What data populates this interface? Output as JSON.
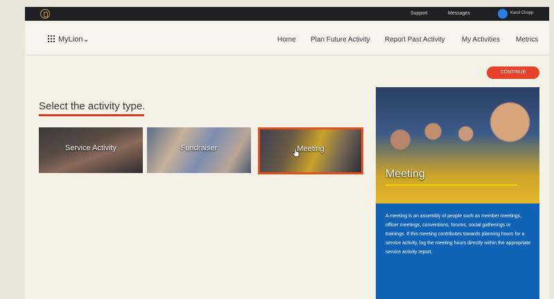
{
  "topbar": {
    "support": "Support",
    "messages": "Messages",
    "user_name": "Karol Chopp"
  },
  "navbar": {
    "brand": "MyLion",
    "items": [
      "Home",
      "Plan Future Activity",
      "Report Past Activity",
      "My Activities",
      "Metrics"
    ]
  },
  "main": {
    "continue_label": "CONTINUE",
    "heading": "Select the activity type.",
    "tiles": [
      {
        "label": "Service Activity"
      },
      {
        "label": "Fundraiser"
      },
      {
        "label": "Meeting",
        "selected": true
      }
    ]
  },
  "detail_panel": {
    "title": "Meeting",
    "description": "A meeting is an assembly of people such as member meetings, officer meetings, conventions, forums, social gatherings or trainings. If this meeting contributes towards planning hours for a service activity, log the meeting hours directly within the appropriate service activity report."
  },
  "colors": {
    "accent": "#e8422a",
    "panel": "#0f62b6",
    "highlight_bar": "#f1c40f"
  }
}
